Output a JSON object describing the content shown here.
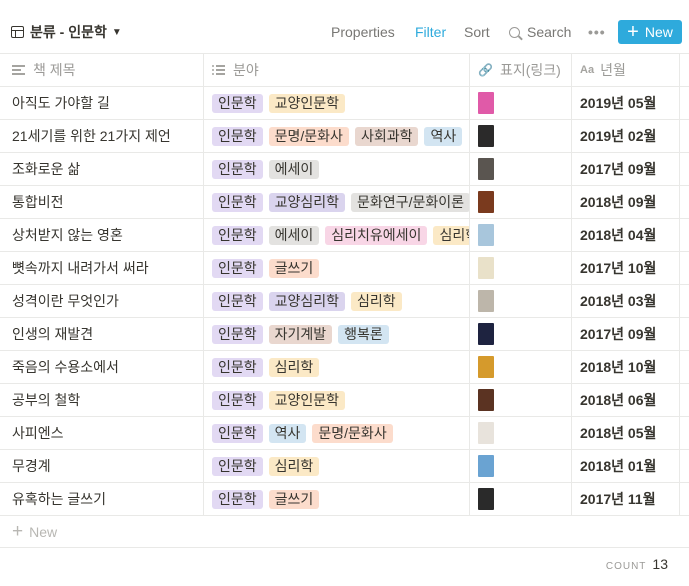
{
  "view": {
    "title": "분류 - 인문학",
    "icon": "table-icon"
  },
  "toolbar": {
    "properties": "Properties",
    "filter": "Filter",
    "sort": "Sort",
    "search": "Search",
    "more": "•••",
    "new": "New"
  },
  "columns": [
    {
      "label": "책 제목",
      "icon": "text-lines-icon"
    },
    {
      "label": "분야",
      "icon": "multi-select-icon"
    },
    {
      "label": "표지(링크)",
      "icon": "paperclip-icon"
    },
    {
      "label": "년월",
      "icon": "text-aa-icon"
    }
  ],
  "tag_colors": {
    "인문학": "#e2d9f3",
    "교양인문학": "#fbe9c6",
    "문명/문화사": "#fcdccc",
    "사회과학": "#e9d7cf",
    "역사": "#d3e5f2",
    "에세이": "#e3e2e0",
    "교양심리학": "#dad4ee",
    "문화연구/문화이론": "#e3e2e0",
    "심리치유에세이": "#f8d6e6",
    "심리학": "#fbe9c6",
    "글쓰기": "#fcdccc",
    "자기계발": "#e9d7cf",
    "행복론": "#d3e5f2"
  },
  "rows": [
    {
      "title": "아직도 가야할 길",
      "tags": [
        "인문학",
        "교양인문학"
      ],
      "cover": "#e05aa8",
      "date": "2019년 05월"
    },
    {
      "title": "21세기를 위한 21가지 제언",
      "tags": [
        "인문학",
        "문명/문화사",
        "사회과학",
        "역사"
      ],
      "cover": "#2b2a2a",
      "date": "2019년 02월"
    },
    {
      "title": "조화로운 삶",
      "tags": [
        "인문학",
        "에세이"
      ],
      "cover": "#5a5550",
      "date": "2017년 09월"
    },
    {
      "title": "통합비전",
      "tags": [
        "인문학",
        "교양심리학",
        "문화연구/문화이론"
      ],
      "cover": "#7a3a1e",
      "date": "2018년 09월"
    },
    {
      "title": "상처받지 않는 영혼",
      "tags": [
        "인문학",
        "에세이",
        "심리치유에세이",
        "심리학"
      ],
      "cover": "#a8c6dc",
      "date": "2018년 04월"
    },
    {
      "title": "뼛속까지 내려가서 써라",
      "tags": [
        "인문학",
        "글쓰기"
      ],
      "cover": "#e9e1c9",
      "date": "2017년 10월"
    },
    {
      "title": "성격이란 무엇인가",
      "tags": [
        "인문학",
        "교양심리학",
        "심리학"
      ],
      "cover": "#bdb6aa",
      "date": "2018년 03월"
    },
    {
      "title": "인생의 재발견",
      "tags": [
        "인문학",
        "자기계발",
        "행복론"
      ],
      "cover": "#1e2340",
      "date": "2017년 09월"
    },
    {
      "title": "죽음의 수용소에서",
      "tags": [
        "인문학",
        "심리학"
      ],
      "cover": "#d59a2c",
      "date": "2018년 10월"
    },
    {
      "title": "공부의 철학",
      "tags": [
        "인문학",
        "교양인문학"
      ],
      "cover": "#5b3322",
      "date": "2018년 06월"
    },
    {
      "title": "사피엔스",
      "tags": [
        "인문학",
        "역사",
        "문명/문화사"
      ],
      "cover": "#e8e3dc",
      "date": "2018년 05월"
    },
    {
      "title": "무경계",
      "tags": [
        "인문학",
        "심리학"
      ],
      "cover": "#6aa3d2",
      "date": "2018년 01월"
    },
    {
      "title": "유혹하는 글쓰기",
      "tags": [
        "인문학",
        "글쓰기"
      ],
      "cover": "#2a2a2a",
      "date": "2017년 11월"
    }
  ],
  "footer": {
    "add_label": "New",
    "count_label": "COUNT",
    "count": "13"
  }
}
